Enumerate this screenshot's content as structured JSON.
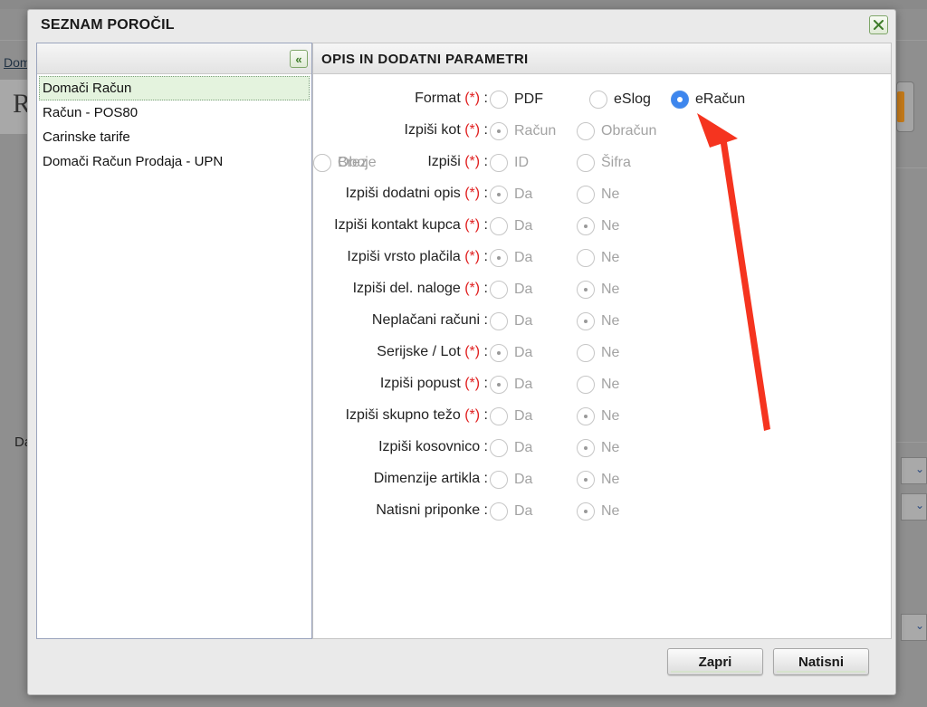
{
  "background": {
    "breadcrumb_link": "Dom",
    "big_letter": "R",
    "da_label": "Da"
  },
  "dialog": {
    "title": "SEZNAM POROČIL",
    "close_label": "✕",
    "collapse_label": "«",
    "left_panel": {
      "items": [
        {
          "label": "Domači Račun",
          "selected": true
        },
        {
          "label": "Račun - POS80",
          "selected": false
        },
        {
          "label": "Carinske tarife",
          "selected": false
        },
        {
          "label": "Domači Račun Prodaja - UPN",
          "selected": false
        }
      ]
    },
    "right_panel": {
      "header": "OPIS IN DODATNI PARAMETRI",
      "required_mark": "(*)",
      "parameters": [
        {
          "label": "Format",
          "required": true,
          "options": [
            {
              "label": "PDF",
              "checked": false,
              "enabled": true
            },
            {
              "label": "eSlog",
              "checked": false,
              "enabled": true
            },
            {
              "label": "eRačun",
              "checked": true,
              "enabled": true
            }
          ]
        },
        {
          "label": "Izpiši kot",
          "required": true,
          "options": [
            {
              "label": "Račun",
              "checked": true,
              "enabled": false
            },
            {
              "label": "Obračun",
              "checked": false,
              "enabled": false
            }
          ]
        },
        {
          "label": "Izpiši",
          "required": true,
          "options": [
            {
              "label": "ID",
              "checked": false,
              "enabled": false
            },
            {
              "label": "Šifra",
              "checked": false,
              "enabled": false
            },
            {
              "label": "Oboje",
              "checked": true,
              "enabled": false
            },
            {
              "label": "Brez",
              "checked": false,
              "enabled": false
            }
          ]
        },
        {
          "label": "Izpiši dodatni opis",
          "required": true,
          "options": [
            {
              "label": "Da",
              "checked": true,
              "enabled": false
            },
            {
              "label": "Ne",
              "checked": false,
              "enabled": false
            }
          ]
        },
        {
          "label": "Izpiši kontakt kupca",
          "required": true,
          "options": [
            {
              "label": "Da",
              "checked": false,
              "enabled": false
            },
            {
              "label": "Ne",
              "checked": true,
              "enabled": false
            }
          ]
        },
        {
          "label": "Izpiši vrsto plačila",
          "required": true,
          "options": [
            {
              "label": "Da",
              "checked": true,
              "enabled": false
            },
            {
              "label": "Ne",
              "checked": false,
              "enabled": false
            }
          ]
        },
        {
          "label": "Izpiši del. naloge",
          "required": true,
          "options": [
            {
              "label": "Da",
              "checked": false,
              "enabled": false
            },
            {
              "label": "Ne",
              "checked": true,
              "enabled": false
            }
          ]
        },
        {
          "label": "Neplačani računi",
          "required": false,
          "options": [
            {
              "label": "Da",
              "checked": false,
              "enabled": false
            },
            {
              "label": "Ne",
              "checked": true,
              "enabled": false
            }
          ]
        },
        {
          "label": "Serijske / Lot",
          "required": true,
          "options": [
            {
              "label": "Da",
              "checked": true,
              "enabled": false
            },
            {
              "label": "Ne",
              "checked": false,
              "enabled": false
            }
          ]
        },
        {
          "label": "Izpiši popust",
          "required": true,
          "options": [
            {
              "label": "Da",
              "checked": true,
              "enabled": false
            },
            {
              "label": "Ne",
              "checked": false,
              "enabled": false
            }
          ]
        },
        {
          "label": "Izpiši skupno težo",
          "required": true,
          "options": [
            {
              "label": "Da",
              "checked": false,
              "enabled": false
            },
            {
              "label": "Ne",
              "checked": true,
              "enabled": false
            }
          ]
        },
        {
          "label": "Izpiši kosovnico",
          "required": false,
          "options": [
            {
              "label": "Da",
              "checked": false,
              "enabled": false
            },
            {
              "label": "Ne",
              "checked": true,
              "enabled": false
            }
          ]
        },
        {
          "label": "Dimenzije artikla",
          "required": false,
          "options": [
            {
              "label": "Da",
              "checked": false,
              "enabled": false
            },
            {
              "label": "Ne",
              "checked": true,
              "enabled": false
            }
          ]
        },
        {
          "label": "Natisni priponke",
          "required": false,
          "options": [
            {
              "label": "Da",
              "checked": false,
              "enabled": false
            },
            {
              "label": "Ne",
              "checked": true,
              "enabled": false
            }
          ]
        }
      ]
    },
    "buttons": {
      "close": "Zapri",
      "print": "Natisni"
    }
  },
  "annotation": {
    "arrow_color": "#f5341f"
  }
}
